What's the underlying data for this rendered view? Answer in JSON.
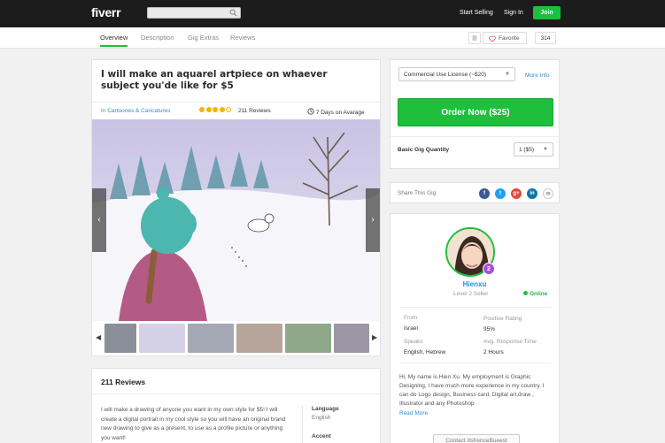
{
  "header": {
    "logo": "fiverr",
    "search": {
      "placeholder": "",
      "icon": "search-icon"
    },
    "start_selling": "Start Selling",
    "sign_in": "Sign In",
    "join": "Join"
  },
  "subnav": {
    "tabs": [
      {
        "label": "Overview",
        "active": true
      },
      {
        "label": "Description",
        "active": false
      },
      {
        "label": "Gig Extras",
        "active": false
      },
      {
        "label": "Reviews",
        "active": false
      }
    ],
    "favorite_label": "Favorite",
    "favorite_count": "314"
  },
  "gig": {
    "title": "I will make an aquarel artpiece on whaever subject you'de like for $5",
    "category_prefix": "In",
    "category": "Cartoones & Caricatures",
    "rating_stars": 4,
    "rating_max": 5,
    "reviews_count": "211 Reviews",
    "delivery": "7 Days on Avarage"
  },
  "order": {
    "license_select": "Commercial Use License (~$20)",
    "more_info": "More Info",
    "order_button": "Order Now ($25)",
    "quantity_label": "Basic Gig Quantity",
    "quantity_value": "1 ($5)"
  },
  "share": {
    "label": "Share This Gig",
    "networks": [
      "f",
      "t",
      "g+",
      "in",
      "✉"
    ]
  },
  "seller": {
    "name": "Hienxu",
    "level": "Level 2 Seller",
    "level_badge": "2",
    "status": "Online",
    "stats": [
      {
        "label": "From",
        "value": "Israel"
      },
      {
        "label": "Positive Rating",
        "value": "95%"
      },
      {
        "label": "Speaks",
        "value": "English, Hebrew"
      },
      {
        "label": "Avg. Response Time",
        "value": "2 Hours"
      }
    ],
    "bio": "Hi, My name is Hien Xu. My employment is Graphic Designing, I have much more experience in my country. I can do Logo design, Business card, Digital art,draw , Illustrator and any Photoshop",
    "read_more": "Read More",
    "contact": "Contact ItsfrenceBueest"
  },
  "reviews": {
    "title": "211 Reviews",
    "text": "I will make a drawing of anyone you want in my own style for $5! I will create a digital portrait in my cool style so you will have an original brand new drawing to give as a present, to use as a profile picture or anything you want!",
    "language_label": "Language",
    "language_value": "English",
    "accent_label": "Accent"
  },
  "colors": {
    "brand_green": "#1dbf3c",
    "link_blue": "#2b8fd6",
    "topbar": "#1c1c1c",
    "level_badge": "#a94ee0"
  }
}
